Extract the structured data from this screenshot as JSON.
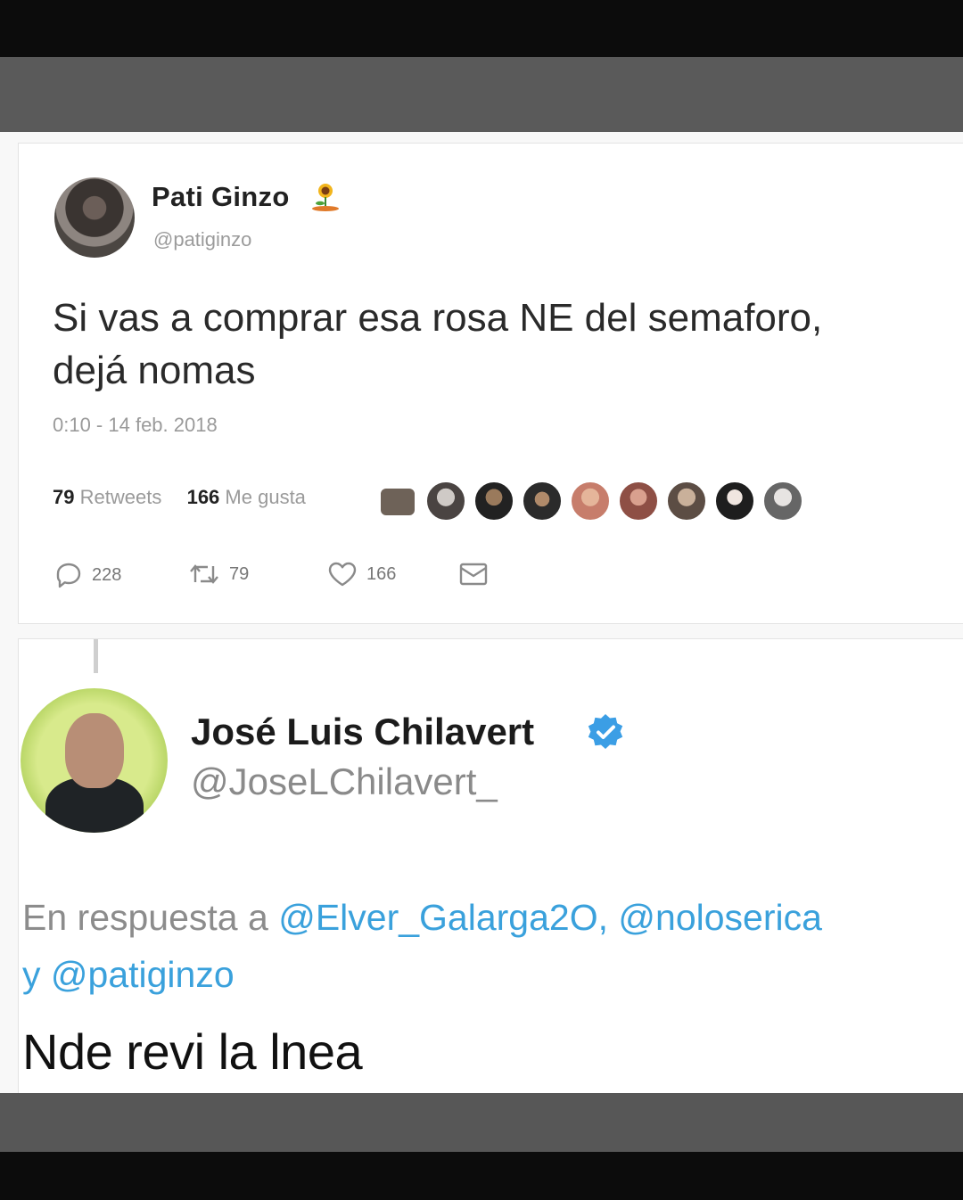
{
  "tweet1": {
    "author": "Pati Ginzo",
    "author_icon": "sunflower-icon",
    "handle": "@patiginzo",
    "text_line1": "Si vas a comprar esa rosa NE del semaforo,",
    "text_line2": "dejá nomas",
    "timestamp": "0:10 - 14 feb. 2018",
    "stats": {
      "retweets_count": "79",
      "retweets_label": "Retweets",
      "likes_count": "166",
      "likes_label": "Me gusta"
    },
    "liker_avatar_count": 9,
    "actions": {
      "reply_count": "228",
      "retweet_count": "79",
      "like_count": "166"
    }
  },
  "tweet2": {
    "author": "José Luis Chilavert",
    "verified_icon": "verified-badge-icon",
    "handle": "@JoseLChilavert_",
    "reply_prefix": "En respuesta a",
    "mention1": "@Elver_Galarga2O,",
    "mention2": "@noloserica",
    "reply_join": "y",
    "mention3": "@patiginzo",
    "text": "Nde revi la lnea"
  },
  "colors": {
    "mention": "#3aa1dc",
    "verified": "#3b9ee5",
    "muted_text": "#9a9a9a"
  }
}
